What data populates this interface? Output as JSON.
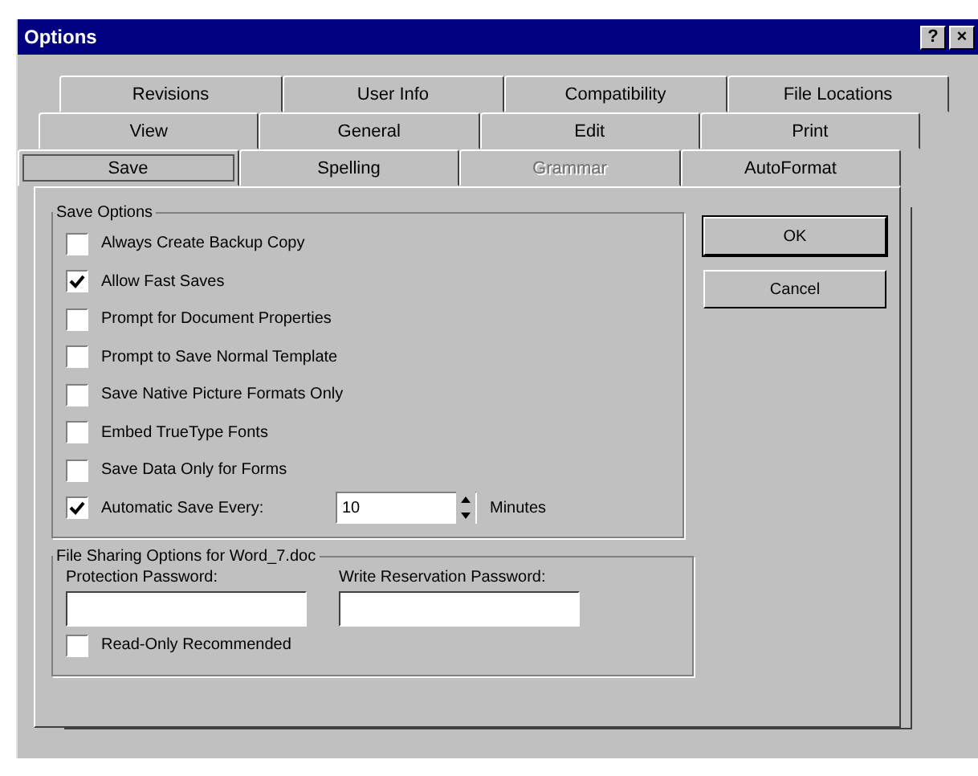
{
  "window": {
    "title": "Options",
    "help_button": "?",
    "close_button": "×"
  },
  "tab_rows": [
    [
      {
        "label": "Revisions",
        "selected": false,
        "disabled": false
      },
      {
        "label": "User Info",
        "selected": false,
        "disabled": false
      },
      {
        "label": "Compatibility",
        "selected": false,
        "disabled": false
      },
      {
        "label": "File Locations",
        "selected": false,
        "disabled": false
      }
    ],
    [
      {
        "label": "View",
        "selected": false,
        "disabled": false
      },
      {
        "label": "General",
        "selected": false,
        "disabled": false
      },
      {
        "label": "Edit",
        "selected": false,
        "disabled": false
      },
      {
        "label": "Print",
        "selected": false,
        "disabled": false
      }
    ],
    [
      {
        "label": "Save",
        "selected": true,
        "disabled": false
      },
      {
        "label": "Spelling",
        "selected": false,
        "disabled": false
      },
      {
        "label": "Grammar",
        "selected": false,
        "disabled": true
      },
      {
        "label": "AutoFormat",
        "selected": false,
        "disabled": false
      }
    ]
  ],
  "save_options": {
    "title": "Save Options",
    "options": [
      {
        "label": "Always Create Backup Copy",
        "checked": false
      },
      {
        "label": "Allow Fast Saves",
        "checked": true
      },
      {
        "label": "Prompt for Document Properties",
        "checked": false
      },
      {
        "label": "Prompt to Save Normal Template",
        "checked": false
      },
      {
        "label": "Save Native Picture Formats Only",
        "checked": false
      },
      {
        "label": "Embed TrueType Fonts",
        "checked": false
      },
      {
        "label": "Save Data Only for Forms",
        "checked": false
      }
    ],
    "autosave": {
      "label": "Automatic Save Every:",
      "checked": true,
      "value": "10",
      "unit": "Minutes"
    }
  },
  "file_sharing": {
    "title": "File Sharing Options for Word_7.doc",
    "protection_password": {
      "label": "Protection Password:"
    },
    "write_reservation_password": {
      "label": "Write Reservation Password:"
    },
    "read_only": {
      "label": "Read-Only Recommended",
      "checked": false
    }
  },
  "buttons": [
    "OK",
    "Cancel"
  ]
}
